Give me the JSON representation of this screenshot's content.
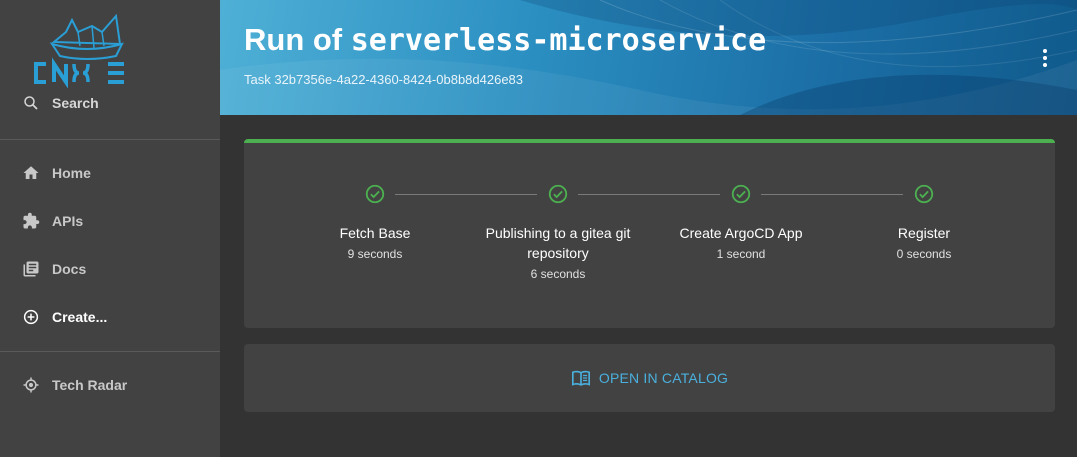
{
  "sidebar": {
    "logo_text": "CNOE",
    "search_label": "Search",
    "items": [
      {
        "label": "Home",
        "icon": "home-icon"
      },
      {
        "label": "APIs",
        "icon": "puzzle-icon"
      },
      {
        "label": "Docs",
        "icon": "library-icon"
      },
      {
        "label": "Create...",
        "icon": "add-circle-icon",
        "active": true
      },
      {
        "label": "Tech Radar",
        "icon": "radar-icon"
      }
    ]
  },
  "header": {
    "title_prefix": "Run of ",
    "title_template": "serverless-microservice",
    "subtitle": "Task 32b7356e-4a22-4360-8424-0b8b8d426e83",
    "menu_icon": "more-vertical-icon"
  },
  "steps": [
    {
      "label": "Fetch Base",
      "duration": "9 seconds",
      "status": "completed"
    },
    {
      "label": "Publishing to a gitea git repository",
      "duration": "6 seconds",
      "status": "completed"
    },
    {
      "label": "Create ArgoCD App",
      "duration": "1 second",
      "status": "completed"
    },
    {
      "label": "Register",
      "duration": "0 seconds",
      "status": "completed"
    }
  ],
  "catalog_button": {
    "label": "OPEN IN CATALOG",
    "icon": "book-icon"
  },
  "colors": {
    "sidebar_bg": "#424242",
    "page_bg": "#333333",
    "success": "#4caf50",
    "link": "#4ab0de",
    "logo": "#2a9fd6"
  }
}
